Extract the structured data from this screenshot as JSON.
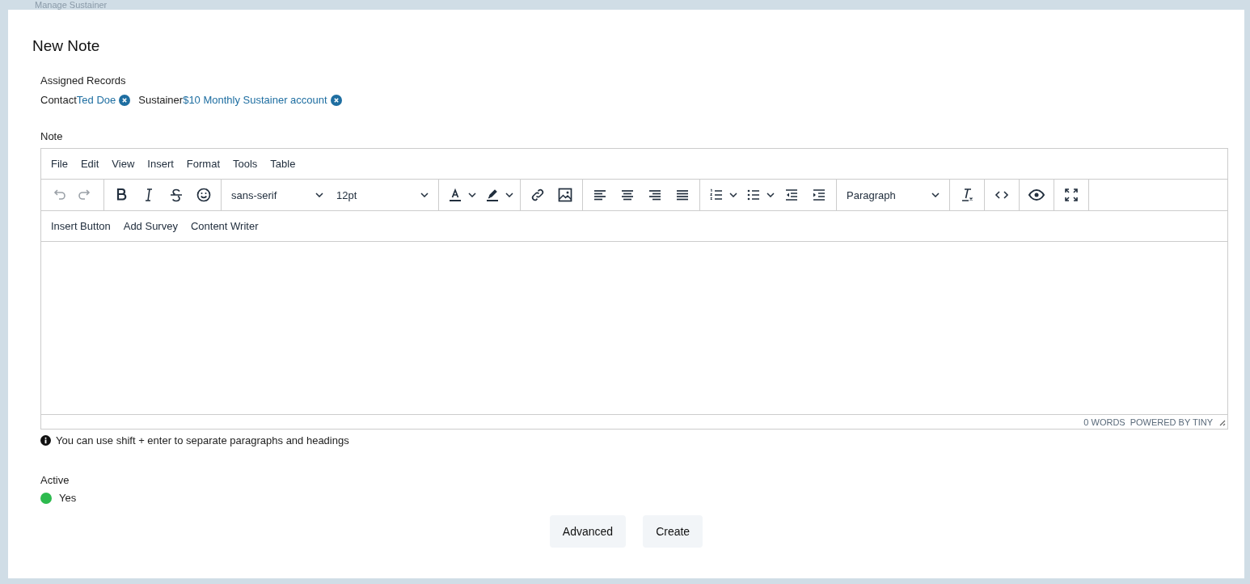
{
  "background": {
    "page_title": "Manage Sustainer"
  },
  "dialog": {
    "title": "New Note",
    "assigned_records": {
      "label": "Assigned Records",
      "records": [
        {
          "type": "Contact",
          "name": "Ted Doe"
        },
        {
          "type": "Sustainer",
          "name": "$10 Monthly Sustainer account"
        }
      ]
    },
    "note": {
      "label": "Note",
      "menubar": [
        "File",
        "Edit",
        "View",
        "Insert",
        "Format",
        "Tools",
        "Table"
      ],
      "history": [
        {
          "disabled": true
        },
        {
          "disabled": true
        }
      ],
      "font_family": "sans-serif",
      "font_size": "12pt",
      "block_format": "Paragraph",
      "custom_buttons": [
        "Insert Button",
        "Add Survey",
        "Content Writer"
      ],
      "word_count": "0 WORDS",
      "branding": "POWERED BY TINY",
      "hint": "You can use shift + enter to separate paragraphs and headings"
    },
    "active": {
      "label": "Active",
      "on": true,
      "value": "Yes"
    },
    "buttons": [
      "Advanced",
      "Create"
    ]
  }
}
